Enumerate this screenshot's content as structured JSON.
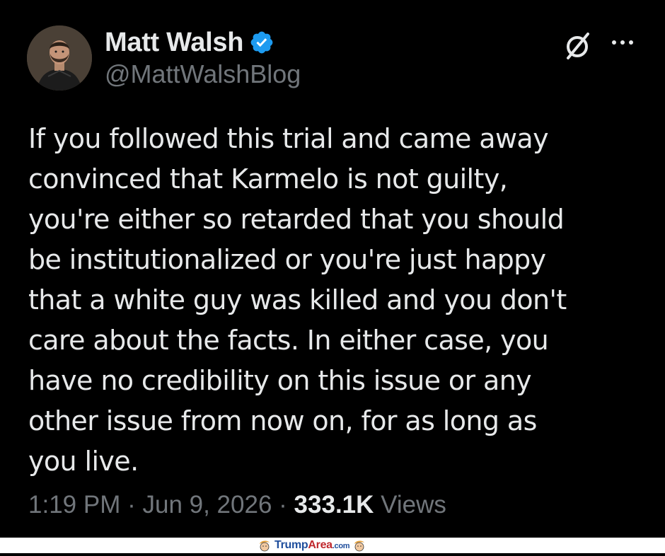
{
  "author": {
    "display_name": "Matt Walsh",
    "handle": "@MattWalshBlog",
    "verified_icon": "verified-badge-icon",
    "verified_color": "#1d9bf0"
  },
  "actions": {
    "grok_icon": "grok-slash-icon",
    "more_icon": "more-options-icon"
  },
  "tweet": {
    "text": "If you followed this trial and came away\nconvinced that Karmelo is not guilty,\nyou're either so retarded that you should\nbe institutionalized or you're just happy\nthat a white guy was killed and you don't\ncare about the facts. In either case, you\nhave no credibility on this issue or any\nother issue from now on, for as long as\nyou live."
  },
  "meta": {
    "time": "1:19 PM",
    "separator": "·",
    "date": "Jun 9, 2026",
    "views_count": "333.1K",
    "views_label": "Views"
  },
  "watermark": {
    "brand_trump": "Trump",
    "brand_area": "Area",
    "brand_com": ".com"
  },
  "colors": {
    "background": "#000000",
    "text_primary": "#e7e9ea",
    "text_secondary": "#71767b",
    "accent": "#1d9bf0"
  }
}
